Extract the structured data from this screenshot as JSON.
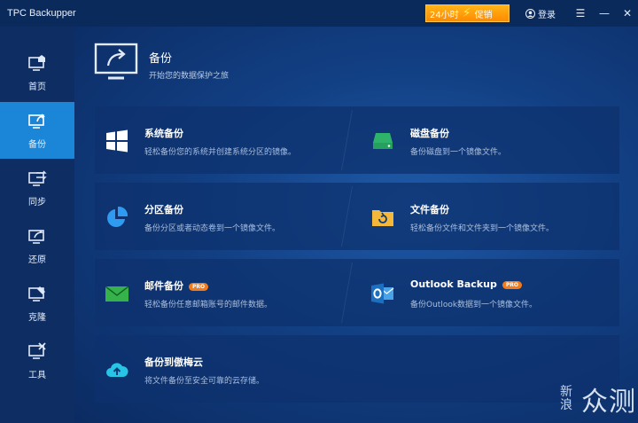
{
  "app": {
    "title": "TPC Backupper"
  },
  "titlebar": {
    "promo_left": "24小时",
    "promo_right": "促销",
    "login": "登录"
  },
  "sidebar": {
    "items": [
      {
        "label": "首页",
        "icon": "home-icon"
      },
      {
        "label": "备份",
        "icon": "backup-icon"
      },
      {
        "label": "同步",
        "icon": "sync-icon"
      },
      {
        "label": "还原",
        "icon": "restore-icon"
      },
      {
        "label": "克隆",
        "icon": "clone-icon"
      },
      {
        "label": "工具",
        "icon": "tools-icon"
      }
    ],
    "active_index": 1
  },
  "header": {
    "title": "备份",
    "subtitle": "开始您的数据保护之旅"
  },
  "options": [
    {
      "title": "系统备份",
      "desc": "轻松备份您的系统并创建系统分区的镜像。",
      "icon": "windows-icon"
    },
    {
      "title": "磁盘备份",
      "desc": "备份磁盘到一个镜像文件。",
      "icon": "disk-icon"
    },
    {
      "title": "分区备份",
      "desc": "备份分区或者动态卷到一个镜像文件。",
      "icon": "pie-chart-icon"
    },
    {
      "title": "文件备份",
      "desc": "轻松备份文件和文件夹到一个镜像文件。",
      "icon": "folder-icon"
    },
    {
      "title": "邮件备份",
      "desc": "轻松备份任意邮箱账号的邮件数据。",
      "icon": "mail-icon",
      "badge": "PRO"
    },
    {
      "title": "Outlook Backup",
      "desc": "备份Outlook数据到一个镜像文件。",
      "icon": "outlook-icon",
      "badge": "PRO"
    },
    {
      "title": "备份到傲梅云",
      "desc": "将文件备份至安全可靠的云存储。",
      "icon": "cloud-upload-icon"
    }
  ],
  "watermark": {
    "small": "新浪",
    "big": "众测"
  },
  "colors": {
    "accent": "#1b86d8",
    "promo": "#ff9a0a",
    "pro_badge": "#f07c1e"
  }
}
